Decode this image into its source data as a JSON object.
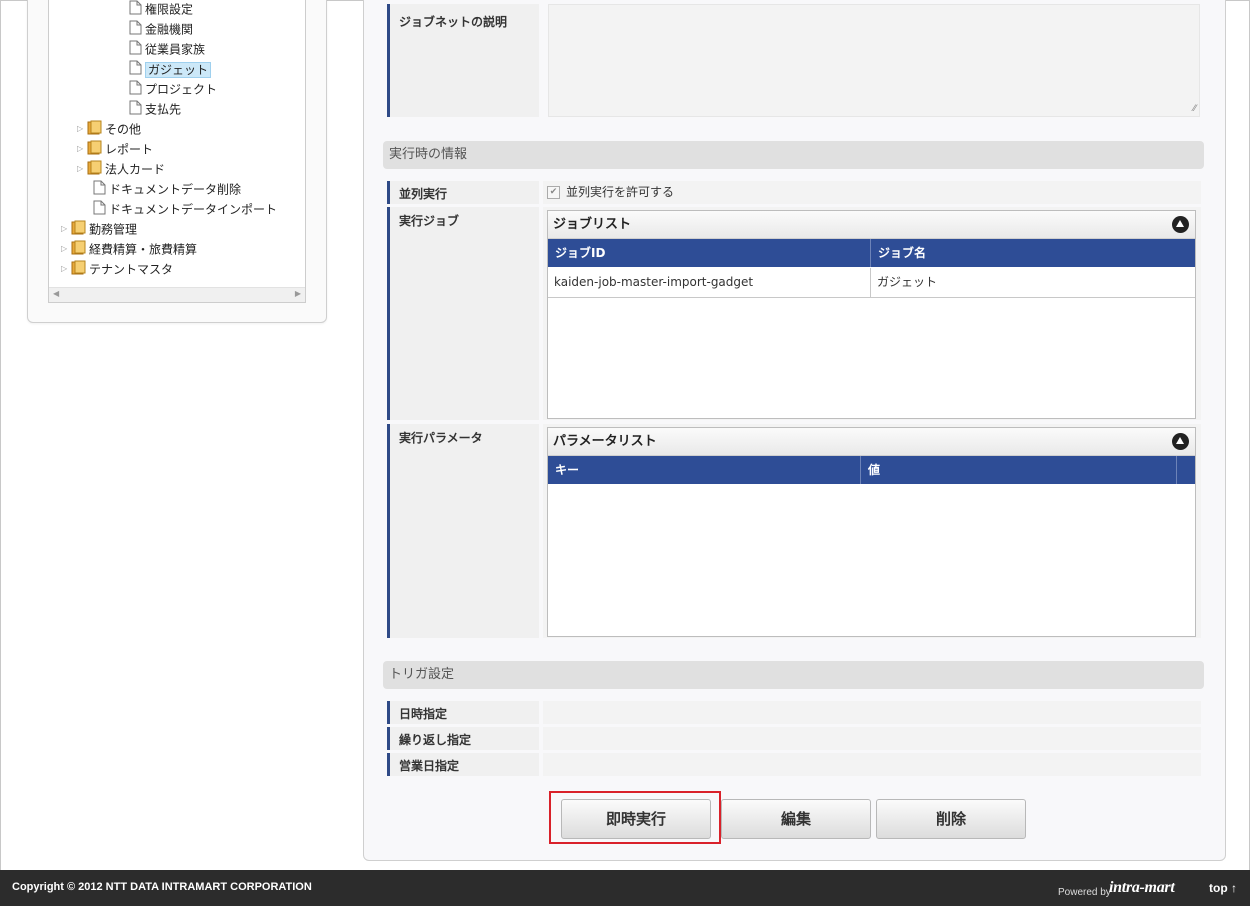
{
  "tree": {
    "items": [
      {
        "label": "権限設定",
        "type": "file",
        "expander": false,
        "selected": false
      },
      {
        "label": "金融機関",
        "type": "file",
        "expander": false,
        "selected": false
      },
      {
        "label": "従業員家族",
        "type": "file",
        "expander": false,
        "selected": false
      },
      {
        "label": "ガジェット",
        "type": "file",
        "expander": false,
        "selected": true
      },
      {
        "label": "プロジェクト",
        "type": "file",
        "expander": false,
        "selected": false
      },
      {
        "label": "支払先",
        "type": "file",
        "expander": false,
        "selected": false
      },
      {
        "label": "その他",
        "type": "folder",
        "expander": true,
        "selected": false
      },
      {
        "label": "レポート",
        "type": "folder",
        "expander": true,
        "selected": false
      },
      {
        "label": "法人カード",
        "type": "folder",
        "expander": true,
        "selected": false
      },
      {
        "label": "ドキュメントデータ削除",
        "type": "file",
        "expander": false,
        "selected": false
      },
      {
        "label": "ドキュメントデータインポート",
        "type": "file",
        "expander": false,
        "selected": false
      },
      {
        "label": "勤務管理",
        "type": "folder",
        "expander": true,
        "selected": false
      },
      {
        "label": "経費精算・旅費精算",
        "type": "folder",
        "expander": true,
        "selected": false
      },
      {
        "label": "テナントマスタ",
        "type": "folder",
        "expander": true,
        "selected": false
      }
    ]
  },
  "jobnet_description": {
    "label": "ジョブネットの説明",
    "value": ""
  },
  "runtime_section": {
    "title": "実行時の情報"
  },
  "parallel": {
    "label": "並列実行",
    "checkbox_label": "並列実行を許可する",
    "checked": true
  },
  "exec_job": {
    "label": "実行ジョブ",
    "list_title": "ジョブリスト",
    "columns": [
      "ジョブID",
      "ジョブ名"
    ],
    "rows": [
      {
        "id": "kaiden-job-master-import-gadget",
        "name": "ガジェット"
      }
    ]
  },
  "exec_params": {
    "label": "実行パラメータ",
    "list_title": "パラメータリスト",
    "columns": [
      "キー",
      "値"
    ]
  },
  "trigger_section": {
    "title": "トリガ設定"
  },
  "trigger_rows": [
    {
      "label": "日時指定"
    },
    {
      "label": "繰り返し指定"
    },
    {
      "label": "営業日指定"
    }
  ],
  "buttons": {
    "run_now": "即時実行",
    "edit": "編集",
    "delete": "削除"
  },
  "footer": {
    "copyright": "Copyright © 2012 NTT DATA INTRAMART CORPORATION",
    "powered_by": "Powered by",
    "logo": "intra-mart",
    "top_link": "top ↑"
  }
}
